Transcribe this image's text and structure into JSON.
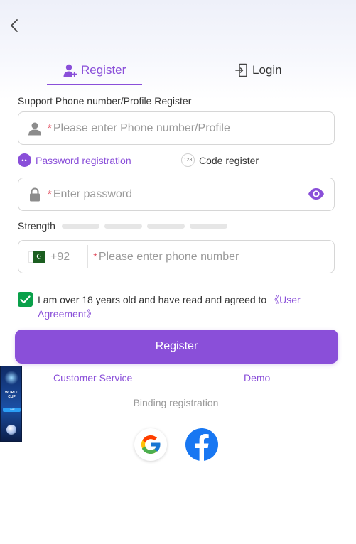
{
  "tabs": {
    "register_label": "Register",
    "login_label": "Login"
  },
  "form": {
    "support_label": "Support Phone number/Profile Register",
    "phone_profile": {
      "required_mark": "*",
      "placeholder": "Please enter Phone number/Profile"
    },
    "modes": {
      "password_label": "Password registration",
      "password_badge": "••",
      "code_label": "Code register",
      "code_badge": "123"
    },
    "password": {
      "required_mark": "*",
      "placeholder": "Enter password"
    },
    "strength_label": "Strength",
    "strength_level": 0,
    "phone": {
      "country_code": "+92",
      "flag": "pakistan-flag",
      "required_mark": "*",
      "placeholder": "Please enter phone number"
    },
    "agreement": {
      "checked": true,
      "text": "I am over 18 years old and have read and agreed to ",
      "link_text": "《User Agreement》"
    },
    "register_button": "Register"
  },
  "links": {
    "customer_service": "Customer Service",
    "demo": "Demo"
  },
  "binding": {
    "label": "Binding registration",
    "providers": [
      "google-icon",
      "facebook-icon"
    ]
  },
  "promo": {
    "text_line1": "WORLD CUP",
    "text_line2": "LIVE"
  },
  "colors": {
    "accent": "#8a4fd9",
    "checkbox": "#0aa04a",
    "required": "#e0485a",
    "facebook": "#1877f2"
  }
}
